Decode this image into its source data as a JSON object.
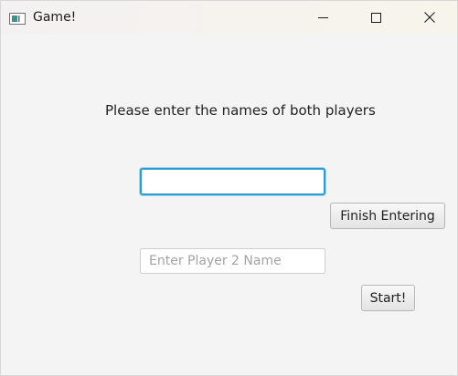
{
  "window": {
    "title": "Game!",
    "controls": [
      "minimize-icon",
      "maximize-icon",
      "close-icon"
    ]
  },
  "form": {
    "prompt": "Please enter the names of both players",
    "player1": {
      "value": "",
      "placeholder": ""
    },
    "player2": {
      "value": "",
      "placeholder": "Enter Player 2 Name"
    },
    "finish_label": "Finish Entering",
    "start_label": "Start!"
  },
  "colors": {
    "focus_border": "#2e9ad4",
    "background": "#f4f4f4"
  }
}
